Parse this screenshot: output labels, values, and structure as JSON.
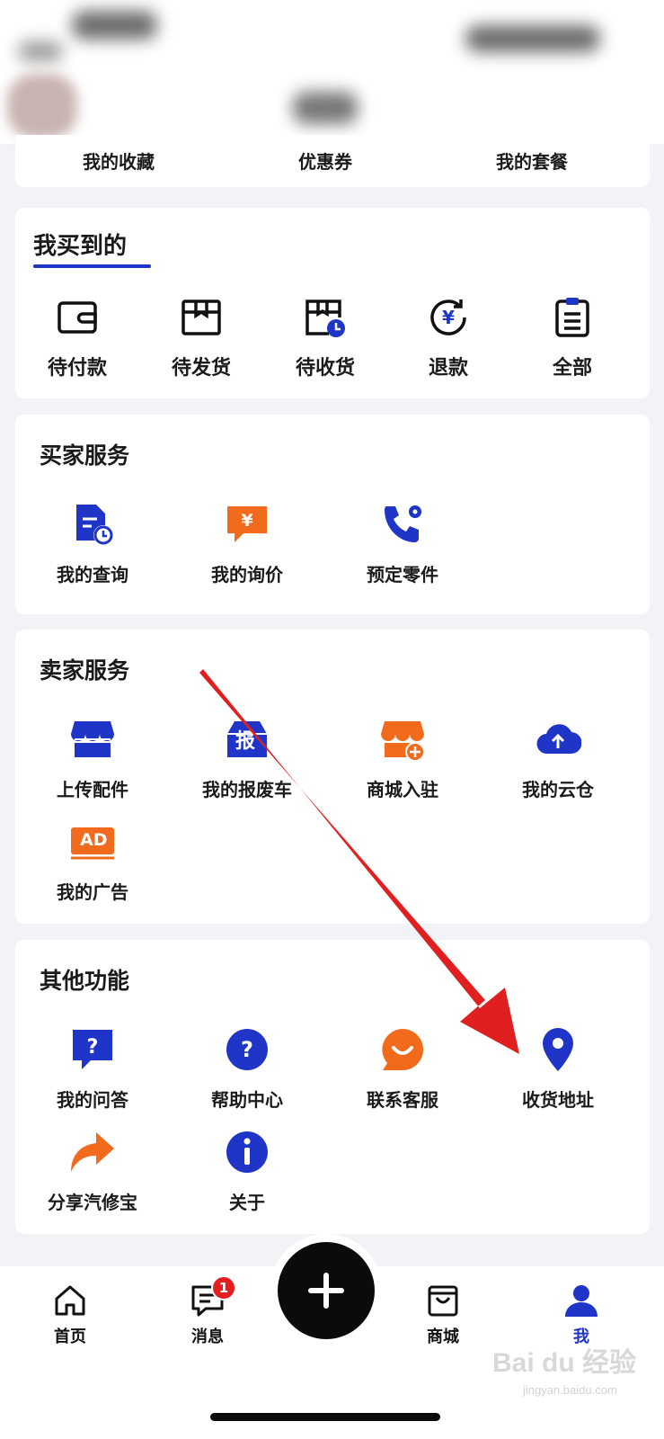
{
  "quick_links": [
    "我的收藏",
    "优惠券",
    "我的套餐"
  ],
  "purchased": {
    "title": "我买到的",
    "items": [
      {
        "label": "待付款",
        "icon": "wallet-icon"
      },
      {
        "label": "待发货",
        "icon": "package-icon"
      },
      {
        "label": "待收货",
        "icon": "delivery-clock-icon"
      },
      {
        "label": "退款",
        "icon": "refund-yuan-icon"
      },
      {
        "label": "全部",
        "icon": "clipboard-list-icon"
      }
    ]
  },
  "buyer_services": {
    "title": "买家服务",
    "items": [
      {
        "label": "我的查询",
        "icon": "document-clock-icon"
      },
      {
        "label": "我的询价",
        "icon": "price-chat-icon"
      },
      {
        "label": "预定零件",
        "icon": "phone-gear-icon"
      }
    ]
  },
  "seller_services": {
    "title": "卖家服务",
    "items": [
      {
        "label": "上传配件",
        "icon": "store-icon"
      },
      {
        "label": "我的报废车",
        "icon": "scrap-car-icon",
        "glyph": "报"
      },
      {
        "label": "商城入驻",
        "icon": "store-plus-icon"
      },
      {
        "label": "我的云仓",
        "icon": "cloud-upload-icon"
      },
      {
        "label": "我的广告",
        "icon": "ad-icon",
        "glyph": "AD"
      }
    ]
  },
  "other_functions": {
    "title": "其他功能",
    "items": [
      {
        "label": "我的问答",
        "icon": "question-chat-icon"
      },
      {
        "label": "帮助中心",
        "icon": "help-icon"
      },
      {
        "label": "联系客服",
        "icon": "customer-service-icon"
      },
      {
        "label": "收货地址",
        "icon": "location-pin-icon"
      },
      {
        "label": "分享汽修宝",
        "icon": "share-arrow-icon"
      },
      {
        "label": "关于",
        "icon": "info-icon"
      }
    ]
  },
  "bottom_nav": {
    "items": [
      {
        "label": "首页",
        "icon": "home-icon"
      },
      {
        "label": "消息",
        "icon": "message-icon",
        "badge": "1"
      },
      {
        "label": "商城",
        "icon": "shopping-bag-icon"
      },
      {
        "label": "我",
        "icon": "user-icon",
        "active": true
      }
    ],
    "center_icon": "plus-icon"
  },
  "watermark": {
    "text": "Bai du 经验",
    "sub": "jingyan.baidu.com"
  },
  "colors": {
    "primary": "#1f35c7",
    "orange": "#f26b1d",
    "annotation_red": "#e02020"
  }
}
